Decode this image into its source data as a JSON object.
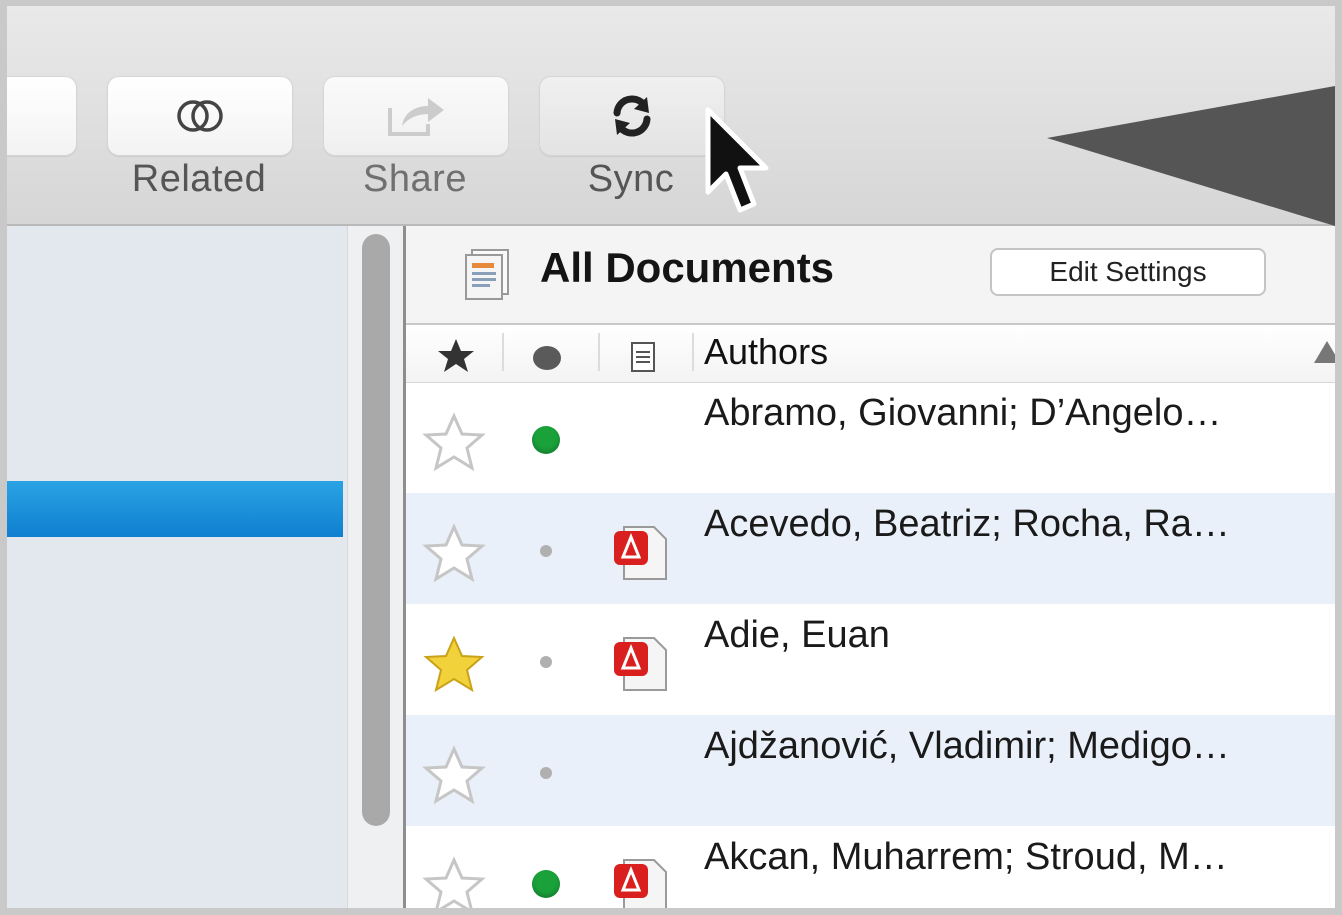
{
  "toolbar": {
    "buttons": [
      {
        "id": "related",
        "label": "Related",
        "icon": "related-circles-icon"
      },
      {
        "id": "share",
        "label": "Share",
        "icon": "share-arrow-icon"
      },
      {
        "id": "sync",
        "label": "Sync",
        "icon": "sync-arrows-icon"
      }
    ]
  },
  "main": {
    "title": "All Documents",
    "edit_settings_label": "Edit Settings",
    "columns": {
      "favorite_icon": "star-icon",
      "read_status_icon": "dot-icon",
      "file_icon": "document-icon",
      "authors": "Authors"
    },
    "rows": [
      {
        "author": "Abramo, Giovanni; D’Angelo…",
        "starred": false,
        "status": "unread",
        "pdf": false
      },
      {
        "author": "Acevedo, Beatriz; Rocha, Ra…",
        "starred": false,
        "status": "read",
        "pdf": true
      },
      {
        "author": "Adie, Euan",
        "starred": true,
        "status": "read",
        "pdf": true
      },
      {
        "author": "Ajdžanović, Vladimir; Medigo…",
        "starred": false,
        "status": "read",
        "pdf": false
      },
      {
        "author": "Akcan, Muharrem; Stroud, M…",
        "starred": false,
        "status": "unread",
        "pdf": true
      }
    ]
  },
  "colors": {
    "selection_blue": "#1a8fd8",
    "unread_green": "#1aa13a",
    "star_gold": "#f2d23a",
    "pdf_red": "#d9201f"
  }
}
